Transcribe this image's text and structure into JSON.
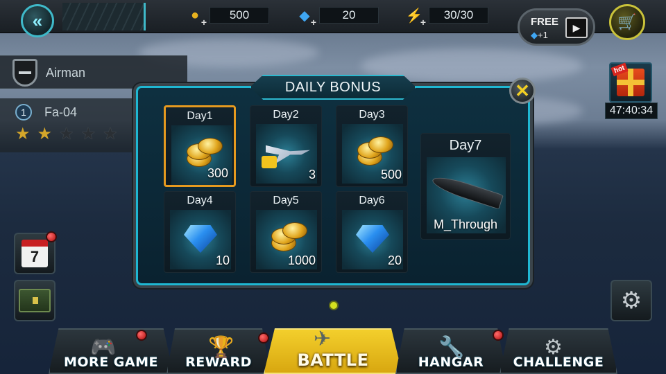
{
  "top_bar": {
    "coins": "500",
    "gems": "20",
    "energy": "30/30",
    "free_label": "FREE",
    "free_reward": "+1"
  },
  "player": {
    "rank": "Airman",
    "level": "1",
    "plane": "Fa-04",
    "stars_total": 5,
    "stars_filled": 2
  },
  "hot_gift": {
    "tag": "hot",
    "timer": "47:40:34"
  },
  "side_buttons": {
    "calendar_number": "7"
  },
  "dialog": {
    "title": "DAILY BONUS",
    "days": [
      {
        "day": "Day1",
        "reward": "300",
        "item": "coins",
        "selected": true
      },
      {
        "day": "Day2",
        "reward": "3",
        "item": "jet-part"
      },
      {
        "day": "Day3",
        "reward": "500",
        "item": "coins"
      },
      {
        "day": "Day4",
        "reward": "10",
        "item": "gems"
      },
      {
        "day": "Day5",
        "reward": "1000",
        "item": "coins"
      },
      {
        "day": "Day6",
        "reward": "20",
        "item": "gems"
      }
    ],
    "day7": {
      "day": "Day7",
      "reward": "M_Through",
      "item": "missile"
    }
  },
  "bottom_nav": {
    "more_game": "MORE GAME",
    "reward": "REWARD",
    "battle": "BATTLE",
    "hangar": "HANGAR",
    "challenge": "CHALLENGE"
  },
  "colors": {
    "accent_cyan": "#1fb7d2",
    "selected_border": "#e69a1f",
    "battle_yellow": "#f3cf2c"
  }
}
